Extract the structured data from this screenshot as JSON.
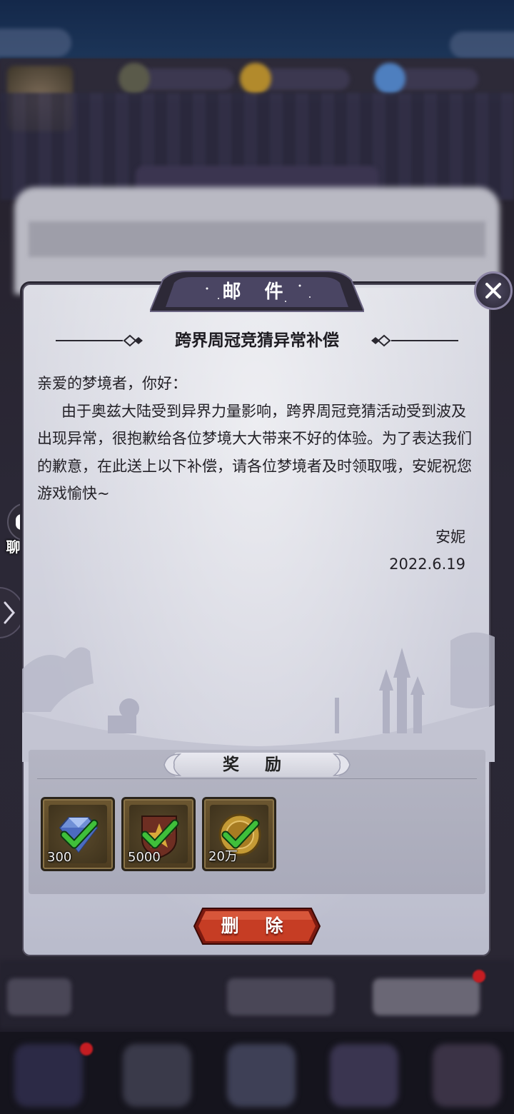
{
  "dialog": {
    "header_title": "邮 件",
    "mail_subject": "跨界周冠竞猜异常补偿",
    "greeting": "亲爱的梦境者，你好：",
    "body": "由于奥兹大陆受到异界力量影响，跨界周冠竞猜活动受到波及出现异常，很抱歉给各位梦境大大带来不好的体验。为了表达我们的歉意，在此送上以下补偿，请各位梦境者及时领取哦，安妮祝您游戏愉快~",
    "signature": "安妮",
    "date": "2022.6.19",
    "close_icon": "close-icon"
  },
  "rewards": {
    "title": "奖 励",
    "items": [
      {
        "icon": "diamond-icon",
        "count": "300",
        "claimed": true
      },
      {
        "icon": "star-badge-icon",
        "count": "5000",
        "claimed": true
      },
      {
        "icon": "gold-coin-icon",
        "count": "20万",
        "claimed": true
      }
    ]
  },
  "actions": {
    "delete_label": "删 除"
  },
  "side": {
    "chat_label": "聊 天",
    "expand_icon": "chevron-right-icon"
  },
  "colors": {
    "accent_red": "#c63d24",
    "check_green": "#3fbf3a",
    "panel": "#d2d3de"
  }
}
